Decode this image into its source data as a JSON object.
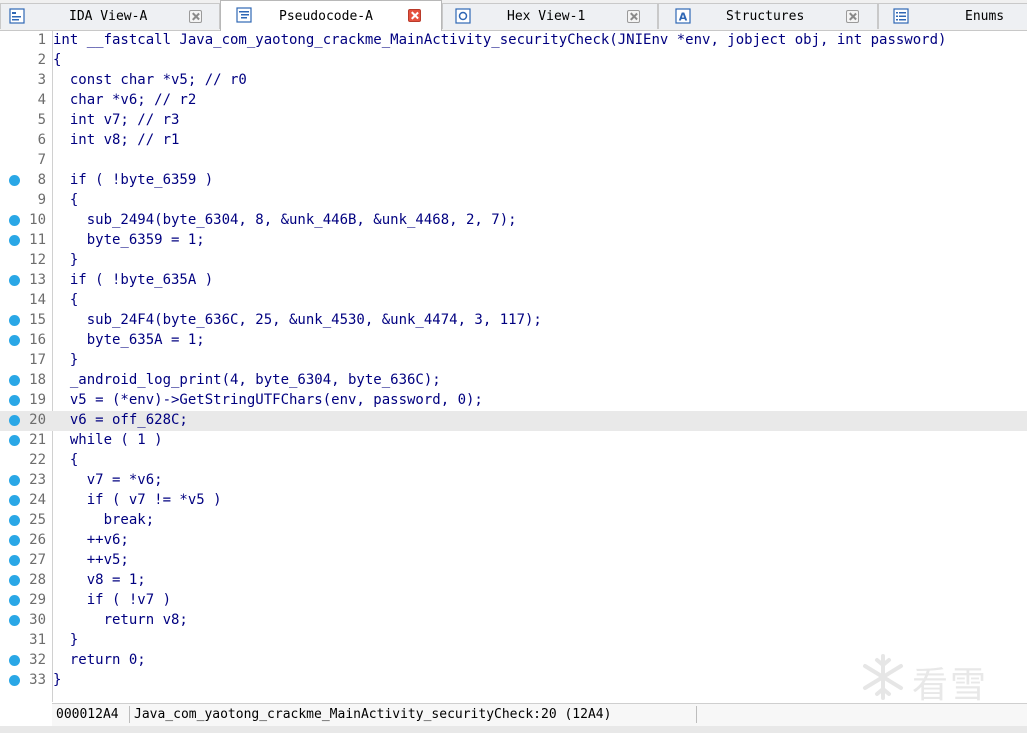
{
  "tabs": [
    {
      "label": "IDA View-A",
      "icon": "ida-view-icon",
      "active": false
    },
    {
      "label": "Pseudocode-A",
      "icon": "pseudocode-icon",
      "active": true
    },
    {
      "label": "Hex View-1",
      "icon": "hex-view-icon",
      "active": false
    },
    {
      "label": "Structures",
      "icon": "structures-icon",
      "active": false
    },
    {
      "label": "Enums",
      "icon": "enums-icon",
      "active": false
    }
  ],
  "code": {
    "selected_line": 20,
    "lines": [
      {
        "n": "1",
        "bp": false,
        "text": "int __fastcall Java_com_yaotong_crackme_MainActivity_securityCheck(JNIEnv *env, jobject obj, int password)"
      },
      {
        "n": "2",
        "bp": false,
        "text": "{"
      },
      {
        "n": "3",
        "bp": false,
        "text": "  const char *v5; // r0"
      },
      {
        "n": "4",
        "bp": false,
        "text": "  char *v6; // r2"
      },
      {
        "n": "5",
        "bp": false,
        "text": "  int v7; // r3"
      },
      {
        "n": "6",
        "bp": false,
        "text": "  int v8; // r1"
      },
      {
        "n": "7",
        "bp": false,
        "text": ""
      },
      {
        "n": "8",
        "bp": true,
        "text": "  if ( !byte_6359 )"
      },
      {
        "n": "9",
        "bp": false,
        "text": "  {"
      },
      {
        "n": "10",
        "bp": true,
        "text": "    sub_2494(byte_6304, 8, &unk_446B, &unk_4468, 2, 7);"
      },
      {
        "n": "11",
        "bp": true,
        "text": "    byte_6359 = 1;"
      },
      {
        "n": "12",
        "bp": false,
        "text": "  }"
      },
      {
        "n": "13",
        "bp": true,
        "text": "  if ( !byte_635A )"
      },
      {
        "n": "14",
        "bp": false,
        "text": "  {"
      },
      {
        "n": "15",
        "bp": true,
        "text": "    sub_24F4(byte_636C, 25, &unk_4530, &unk_4474, 3, 117);"
      },
      {
        "n": "16",
        "bp": true,
        "text": "    byte_635A = 1;"
      },
      {
        "n": "17",
        "bp": false,
        "text": "  }"
      },
      {
        "n": "18",
        "bp": true,
        "text": "  _android_log_print(4, byte_6304, byte_636C);"
      },
      {
        "n": "19",
        "bp": true,
        "text": "  v5 = (*env)->GetStringUTFChars(env, password, 0);"
      },
      {
        "n": "20",
        "bp": true,
        "text": "  v6 = off_628C;"
      },
      {
        "n": "21",
        "bp": true,
        "text": "  while ( 1 )"
      },
      {
        "n": "22",
        "bp": false,
        "text": "  {"
      },
      {
        "n": "23",
        "bp": true,
        "text": "    v7 = *v6;"
      },
      {
        "n": "24",
        "bp": true,
        "text": "    if ( v7 != *v5 )"
      },
      {
        "n": "25",
        "bp": true,
        "text": "      break;"
      },
      {
        "n": "26",
        "bp": true,
        "text": "    ++v6;"
      },
      {
        "n": "27",
        "bp": true,
        "text": "    ++v5;"
      },
      {
        "n": "28",
        "bp": true,
        "text": "    v8 = 1;"
      },
      {
        "n": "29",
        "bp": true,
        "text": "    if ( !v7 )"
      },
      {
        "n": "30",
        "bp": true,
        "text": "      return v8;"
      },
      {
        "n": "31",
        "bp": false,
        "text": "  }"
      },
      {
        "n": "32",
        "bp": true,
        "text": "  return 0;"
      },
      {
        "n": "33",
        "bp": true,
        "text": "}"
      }
    ]
  },
  "status": {
    "address": "000012A4",
    "function": "Java_com_yaotong_crackme_MainActivity_securityCheck:20 (12A4)"
  },
  "watermark": {
    "text": "看雪",
    "icon": "snowflake-logo-icon"
  },
  "colors": {
    "code_text": "#000080",
    "comment_gray": "#808080",
    "breakpoint_dot": "#2aa7e6",
    "selected_line_bg": "#e9e9e9",
    "active_tab_close": "#e5523f"
  }
}
